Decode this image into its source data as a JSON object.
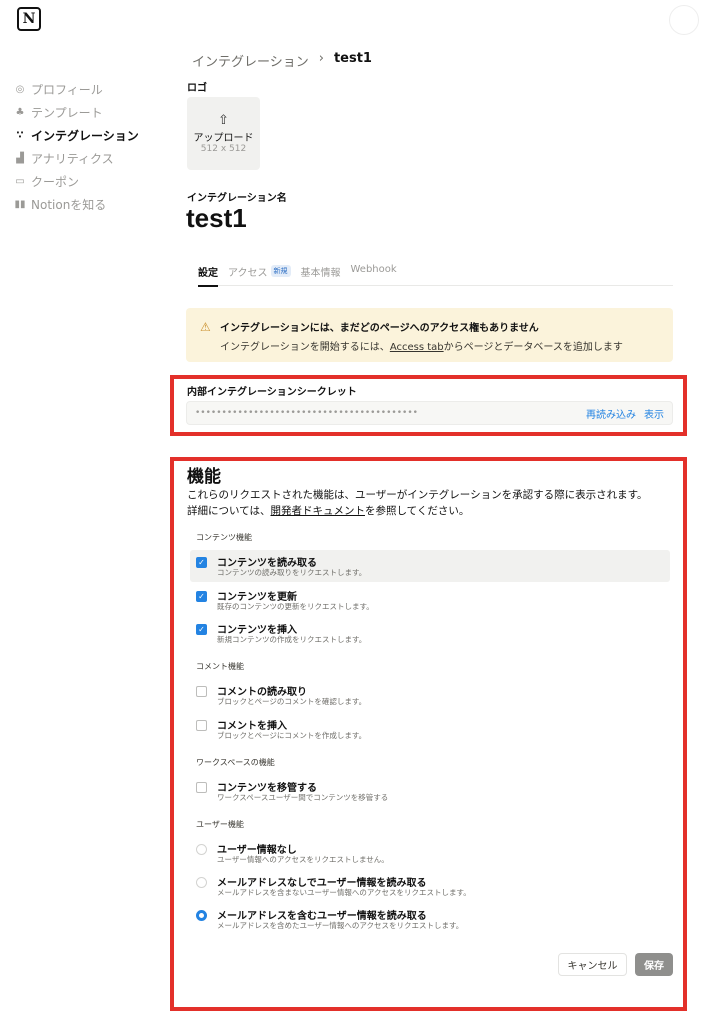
{
  "app": {
    "logo_letter": "N"
  },
  "sidebar": {
    "items": [
      {
        "label": "プロフィール",
        "icon": "user-circle-icon"
      },
      {
        "label": "テンプレート",
        "icon": "shapes-icon"
      },
      {
        "label": "インテグレーション",
        "icon": "integration-icon"
      },
      {
        "label": "アナリティクス",
        "icon": "chart-icon"
      },
      {
        "label": "クーポン",
        "icon": "ticket-icon"
      },
      {
        "label": "Notionを知る",
        "icon": "book-icon"
      }
    ]
  },
  "breadcrumb": {
    "parent": "インテグレーション",
    "separator": "›",
    "current": "test1"
  },
  "logo_section": {
    "label": "ロゴ",
    "upload_label": "アップロード",
    "size_hint": "512 x 512"
  },
  "integration": {
    "name_label": "インテグレーション名",
    "name": "test1"
  },
  "tabs": [
    {
      "label": "設定"
    },
    {
      "label": "アクセス",
      "badge": "新規"
    },
    {
      "label": "基本情報"
    },
    {
      "label": "Webhook"
    }
  ],
  "warning": {
    "title": "インテグレーションには、まだどのページへのアクセス権もありません",
    "body_prefix": "インテグレーションを開始するには、",
    "link": "Access tab",
    "body_suffix": "からページとデータベースを追加します"
  },
  "secret": {
    "label": "内部インテグレーションシークレット",
    "masked": "••••••••••••••••••••••••••••••••••••••••••",
    "reload_label": "再読み込み",
    "show_label": "表示"
  },
  "capabilities": {
    "title": "機能",
    "desc_line1": "これらのリクエストされた機能は、ユーザーがインテグレーションを承認する際に表示されます。",
    "desc_prefix": "詳細については、",
    "desc_link": "開発者ドキュメント",
    "desc_suffix": "を参照してください。",
    "content_label": "コンテンツ機能",
    "content": [
      {
        "title": "コンテンツを読み取る",
        "sub": "コンテンツの読み取りをリクエストします。",
        "checked": true
      },
      {
        "title": "コンテンツを更新",
        "sub": "既存のコンテンツの更新をリクエストします。",
        "checked": true
      },
      {
        "title": "コンテンツを挿入",
        "sub": "新規コンテンツの作成をリクエストします。",
        "checked": true
      }
    ],
    "comment_label": "コメント機能",
    "comment": [
      {
        "title": "コメントの読み取り",
        "sub": "ブロックとページのコメントを確認します。",
        "checked": false
      },
      {
        "title": "コメントを挿入",
        "sub": "ブロックとページにコメントを作成します。",
        "checked": false
      }
    ],
    "workspace_label": "ワークスペースの機能",
    "workspace": [
      {
        "title": "コンテンツを移管する",
        "sub": "ワークスペースユーザー間でコンテンツを移管する",
        "checked": false
      }
    ],
    "user_label": "ユーザー機能",
    "user": [
      {
        "title": "ユーザー情報なし",
        "sub": "ユーザー情報へのアクセスをリクエストしません。",
        "selected": false
      },
      {
        "title": "メールアドレスなしでユーザー情報を読み取る",
        "sub": "メールアドレスを含まないユーザー情報へのアクセスをリクエストします。",
        "selected": false
      },
      {
        "title": "メールアドレスを含むユーザー情報を読み取る",
        "sub": "メールアドレスを含めたユーザー情報へのアクセスをリクエストします。",
        "selected": true
      }
    ]
  },
  "actions": {
    "cancel": "キャンセル",
    "save": "保存"
  },
  "colors": {
    "accent": "#2383e2",
    "highlight_border": "#e3302a",
    "warning_bg": "#fbf3db"
  }
}
